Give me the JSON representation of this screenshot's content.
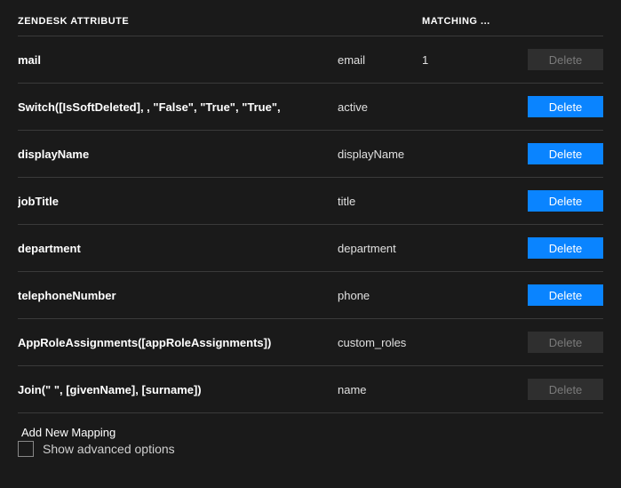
{
  "headers": {
    "zendesk": "ZENDESK ATTRIBUTE",
    "matching": "MATCHING ..."
  },
  "rows": [
    {
      "zd": "mail",
      "app": "email",
      "match": "1",
      "delete_enabled": false
    },
    {
      "zd": "Switch([IsSoftDeleted], , \"False\", \"True\", \"True\",",
      "app": "active",
      "match": "",
      "delete_enabled": true
    },
    {
      "zd": "displayName",
      "app": "displayName",
      "match": "",
      "delete_enabled": true
    },
    {
      "zd": "jobTitle",
      "app": "title",
      "match": "",
      "delete_enabled": true
    },
    {
      "zd": "department",
      "app": "department",
      "match": "",
      "delete_enabled": true
    },
    {
      "zd": "telephoneNumber",
      "app": "phone",
      "match": "",
      "delete_enabled": true
    },
    {
      "zd": "AppRoleAssignments([appRoleAssignments])",
      "app": "custom_roles",
      "match": "",
      "delete_enabled": false
    },
    {
      "zd": "Join(\" \", [givenName], [surname])",
      "app": "name",
      "match": "",
      "delete_enabled": false
    }
  ],
  "labels": {
    "delete": "Delete",
    "add": "Add New Mapping",
    "advanced": "Show advanced options"
  }
}
